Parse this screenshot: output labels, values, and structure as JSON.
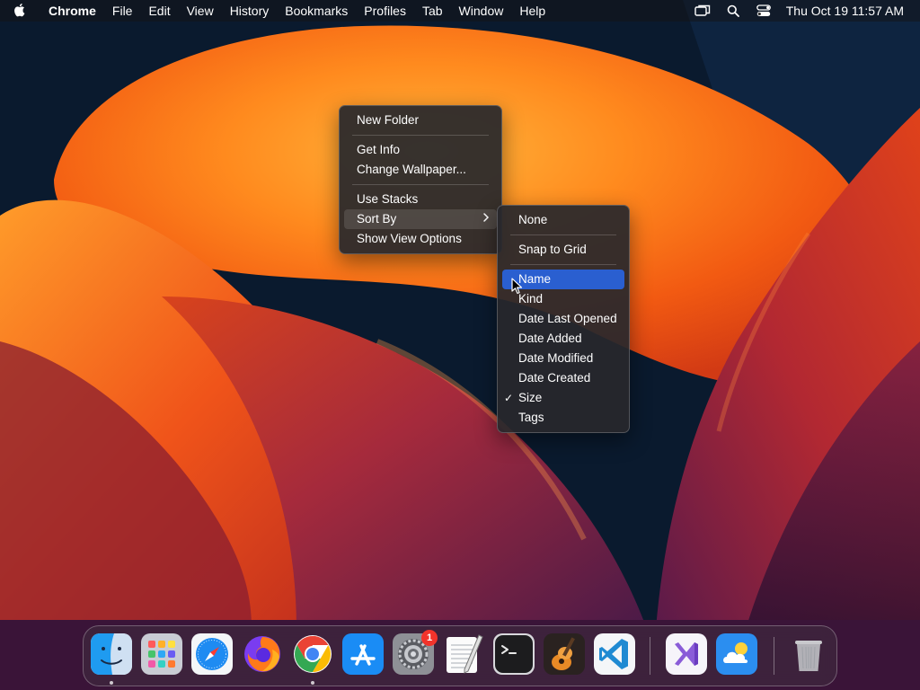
{
  "menubar": {
    "app_name": "Chrome",
    "items": [
      "File",
      "Edit",
      "View",
      "History",
      "Bookmarks",
      "Profiles",
      "Tab",
      "Window",
      "Help"
    ],
    "clock": "Thu Oct 19  11:57 AM"
  },
  "context_menu": {
    "items": [
      {
        "label": "New Folder"
      },
      {
        "label": "Get Info"
      },
      {
        "label": "Change Wallpaper..."
      },
      {
        "label": "Use Stacks"
      },
      {
        "label": "Sort By",
        "submenu": true,
        "state": "open"
      },
      {
        "label": "Show View Options"
      }
    ]
  },
  "sort_submenu": {
    "items": [
      {
        "label": "None"
      },
      {
        "label": "Snap to Grid"
      },
      {
        "label": "Name",
        "state": "highlighted"
      },
      {
        "label": "Kind"
      },
      {
        "label": "Date Last Opened"
      },
      {
        "label": "Date Added"
      },
      {
        "label": "Date Modified"
      },
      {
        "label": "Date Created"
      },
      {
        "label": "Size",
        "checked": true
      },
      {
        "label": "Tags"
      }
    ]
  },
  "dock": {
    "apps": [
      {
        "name": "finder-icon",
        "running": true
      },
      {
        "name": "launchpad-icon"
      },
      {
        "name": "safari-icon"
      },
      {
        "name": "firefox-icon"
      },
      {
        "name": "chrome-icon",
        "running": true
      },
      {
        "name": "app-store-icon"
      },
      {
        "name": "system-settings-icon",
        "badge": "1"
      },
      {
        "name": "textedit-icon"
      },
      {
        "name": "terminal-icon"
      },
      {
        "name": "garageband-icon"
      },
      {
        "name": "vscode-icon"
      },
      {
        "name": "visual-studio-icon"
      },
      {
        "name": "weather-icon"
      },
      {
        "name": "trash-icon"
      }
    ]
  },
  "colors": {
    "highlight": "#2a5fd0",
    "menu_bg": "#28282c",
    "badge": "#f2332b"
  }
}
